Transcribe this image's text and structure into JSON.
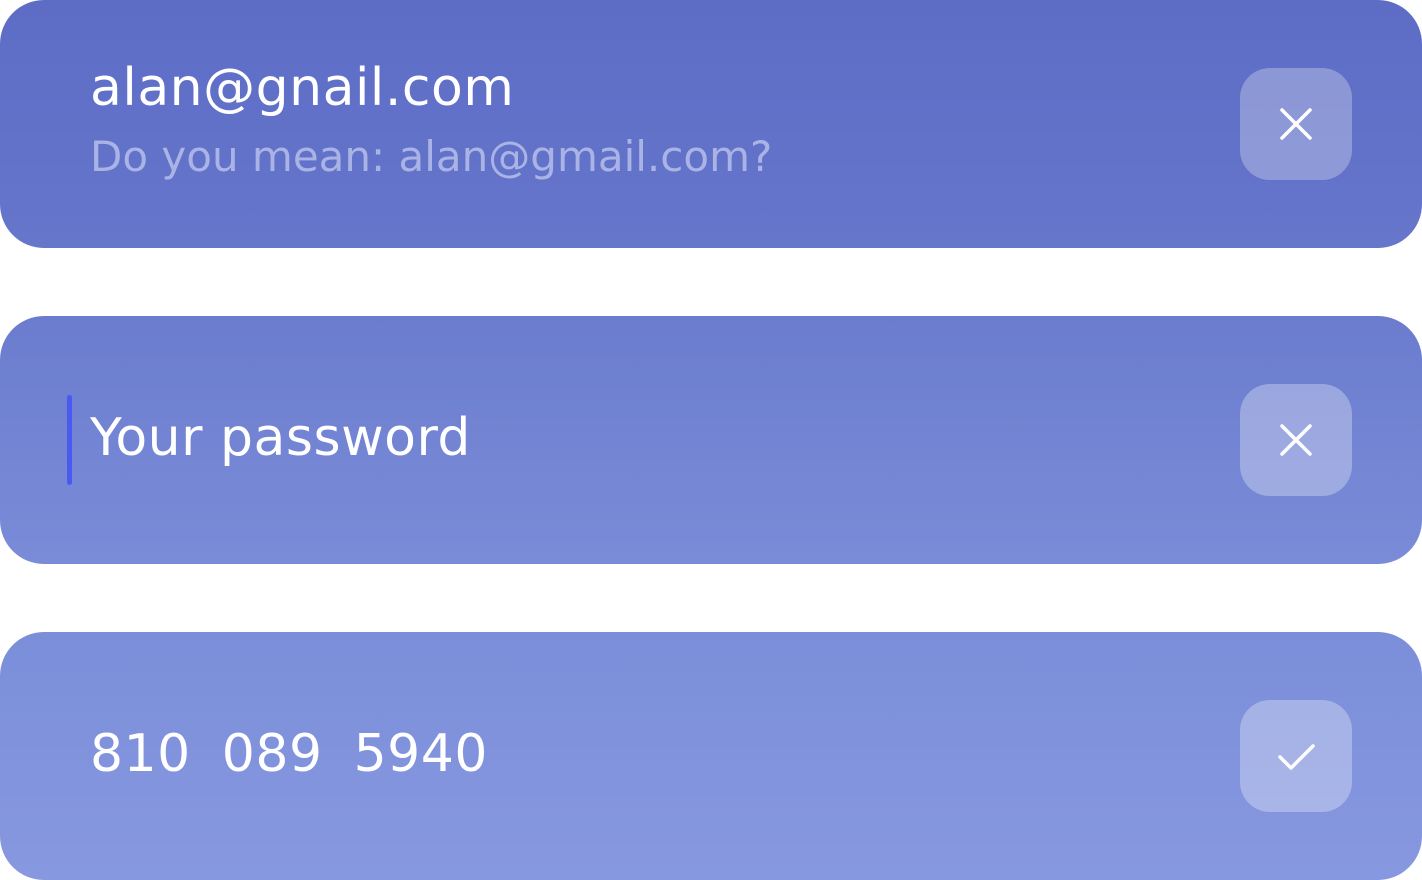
{
  "fields": {
    "email": {
      "value": "alan@gnail.com",
      "hint": "Do you mean: alan@gmail.com?",
      "action_icon": "close-icon"
    },
    "password": {
      "placeholder": "Your password",
      "action_icon": "close-icon"
    },
    "phone": {
      "value": "810  089  5940",
      "action_icon": "check-icon"
    }
  },
  "colors": {
    "text": "#ffffff",
    "hint": "#aab3e6",
    "caret": "#4a5af0"
  }
}
